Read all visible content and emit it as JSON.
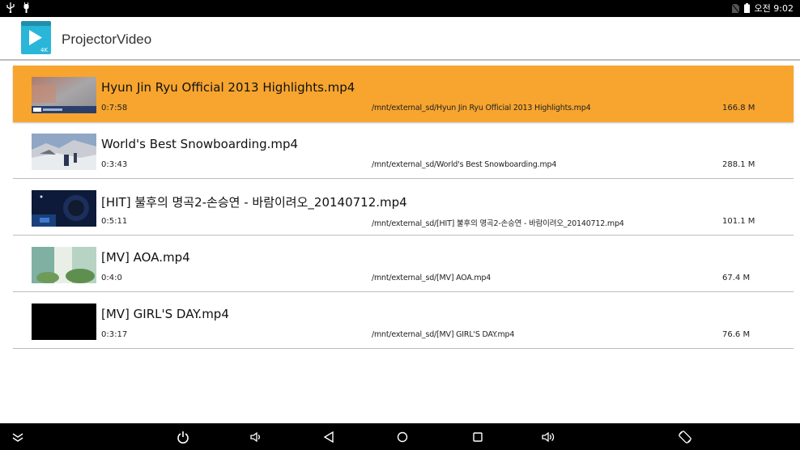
{
  "status_bar": {
    "left_icons": [
      "usb-icon",
      "debug-icon"
    ],
    "right_icons": [
      "no-sim-icon",
      "battery-icon"
    ],
    "time": "오전 9:02"
  },
  "app_bar": {
    "icon": "projector-video-app-icon",
    "icon_badge": "4K",
    "title": "ProjectorVideo"
  },
  "videos": [
    {
      "title": "Hyun Jin Ryu Official 2013 Highlights.mp4",
      "duration": "0:7:58",
      "path": "/mnt/external_sd/Hyun Jin Ryu Official 2013 Highlights.mp4",
      "size": "166.8 M",
      "selected": true
    },
    {
      "title": "World's Best Snowboarding.mp4",
      "duration": "0:3:43",
      "path": "/mnt/external_sd/World's Best Snowboarding.mp4",
      "size": "288.1 M",
      "selected": false
    },
    {
      "title": "[HIT] 불후의 명곡2-손승연 - 바람이려오_20140712.mp4",
      "duration": "0:5:11",
      "path": "/mnt/external_sd/[HIT] 불후의 명곡2-손승연 - 바람이려오_20140712.mp4",
      "size": "101.1 M",
      "selected": false
    },
    {
      "title": "[MV] AOA.mp4",
      "duration": "0:4:0",
      "path": "/mnt/external_sd/[MV] AOA.mp4",
      "size": "67.4 M",
      "selected": false
    },
    {
      "title": "[MV] GIRL'S DAY.mp4",
      "duration": "0:3:17",
      "path": "/mnt/external_sd/[MV] GIRL'S DAY.mp4",
      "size": "76.6 M",
      "selected": false
    }
  ],
  "nav_bar": {
    "buttons": [
      "collapse-icon",
      "power-icon",
      "volume-down-icon",
      "back-icon",
      "home-icon",
      "recents-icon",
      "volume-up-icon",
      "rotate-icon"
    ]
  },
  "colors": {
    "selected_row": "#f7a52f",
    "bars": "#000000",
    "app_icon": "#29b6d8",
    "divider": "#bdbdbd"
  }
}
